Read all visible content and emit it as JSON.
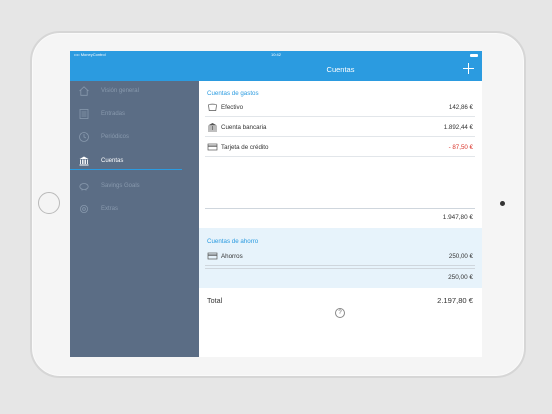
{
  "status": {
    "carrier": "•••• MoneyControl",
    "time": "10:42"
  },
  "nav": {
    "title": "Cuentas"
  },
  "sidebar": {
    "items": [
      {
        "label": "Visión general",
        "icon": "home-icon"
      },
      {
        "label": "Entradas",
        "icon": "list-icon"
      },
      {
        "label": "Periódicos",
        "icon": "clock-icon"
      },
      {
        "label": "Cuentas",
        "icon": "bank-icon",
        "active": true
      },
      {
        "label": "Savings Goals",
        "icon": "piggy-bank-icon"
      },
      {
        "label": "Extras",
        "icon": "gear-icon"
      }
    ]
  },
  "gastos": {
    "header": "Cuentas de gastos",
    "rows": [
      {
        "name": "Efectivo",
        "value": "142,86 €",
        "icon": "cash-icon"
      },
      {
        "name": "Cuenta bancaria",
        "value": "1.892,44 €",
        "icon": "bank-icon"
      },
      {
        "name": "Tarjeta de crédito",
        "value": "- 87,50 €",
        "icon": "credit-card-icon"
      }
    ],
    "subtotal": "1.947,80 €"
  },
  "ahorro": {
    "header": "Cuentas de ahorro",
    "rows": [
      {
        "name": "Ahorros",
        "value": "250,00 €",
        "icon": "savings-card-icon"
      }
    ],
    "subtotal": "250,00 €"
  },
  "total": {
    "label": "Total",
    "value": "2.197,80 €"
  },
  "help": {
    "symbol": "?"
  },
  "colors": {
    "accent": "#2b9be0",
    "sidebar": "#5b6d85",
    "negative": "#d9342b"
  }
}
